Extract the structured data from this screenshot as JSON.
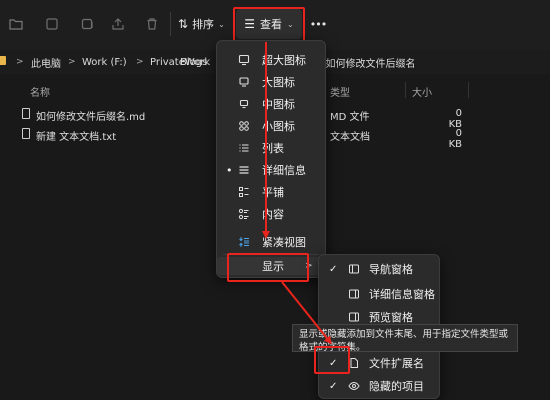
{
  "toolbar": {
    "sort_label": "排序",
    "view_label": "查看",
    "more_label": "•••"
  },
  "address": {
    "segments": [
      "此电脑",
      "Work (F:)",
      "PrivateWork",
      "Blogs"
    ],
    "current_tail": "3.如何修改文件后缀名",
    "separator": ">"
  },
  "columns": {
    "name": "名称",
    "type": "类型",
    "size": "大小"
  },
  "files": [
    {
      "name": "如何修改文件后缀名.md",
      "type": "MD 文件",
      "size": "0 KB"
    },
    {
      "name": "新建 文本文档.txt",
      "type": "文本文档",
      "size": "0 KB"
    }
  ],
  "view_menu": {
    "items": [
      {
        "label": "超大图标",
        "icon": "monitor-icon"
      },
      {
        "label": "大图标",
        "icon": "monitor-icon"
      },
      {
        "label": "中图标",
        "icon": "monitor-icon"
      },
      {
        "label": "小图标",
        "icon": "grid-icon"
      },
      {
        "label": "列表",
        "icon": "list-icon"
      },
      {
        "label": "详细信息",
        "icon": "details-icon",
        "selected": true
      },
      {
        "label": "平铺",
        "icon": "tiles-icon"
      },
      {
        "label": "内容",
        "icon": "content-icon"
      },
      {
        "label": "紧凑视图",
        "icon": "compact-icon"
      }
    ],
    "show_label": "显示",
    "selected_bullet": "•",
    "submenu_arrow": ">"
  },
  "show_submenu": {
    "items": [
      {
        "label": "导航窗格",
        "checked": true,
        "icon": "pane-icon"
      },
      {
        "label": "详细信息窗格",
        "checked": false,
        "icon": "pane-icon"
      },
      {
        "label": "预览窗格",
        "checked": false,
        "icon": "pane-icon"
      },
      {
        "label": "文件扩展名",
        "checked": true,
        "icon": "file-icon"
      },
      {
        "label": "隐藏的项目",
        "checked": true,
        "icon": "eye-icon"
      }
    ],
    "check_mark": "✓"
  },
  "tooltip": {
    "text": "显示或隐藏添加到文件末尾、用于指定文件类型或格式的字符集。"
  },
  "colors": {
    "annotation_red": "#e8241c",
    "background": "#191919",
    "menu_bg": "#2b2b2b",
    "folder_yellow": "#e8b64a"
  }
}
